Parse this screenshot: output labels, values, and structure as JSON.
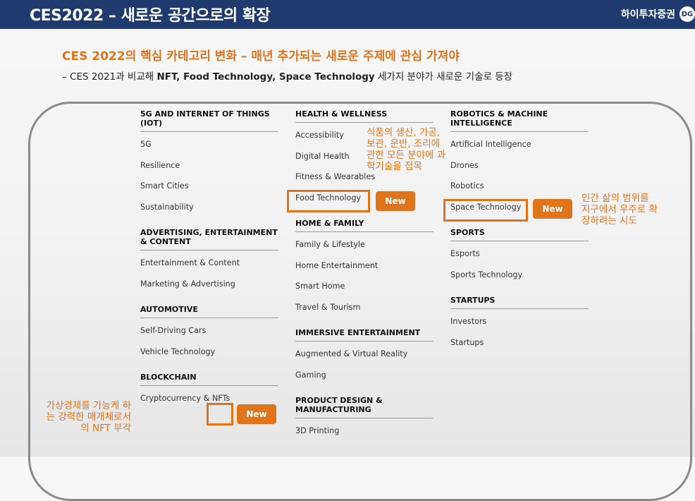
{
  "header": {
    "title": "CES2022 – 새로운 공간으로의 확장",
    "brand": "하이투자증권",
    "brand_logo": "DG"
  },
  "headline": "CES 2022의 핵심 카테고리 변화 – 매년 추가되는 새로운 주제에 관심 가져야",
  "subline": {
    "prefix": "– CES 2021과 비교해 ",
    "bold": "NFT, Food Technology, Space Technology",
    "suffix": " 세가지 분야가 새로운 기술로 등장"
  },
  "accent_color": "#e0741a",
  "columns": [
    {
      "sections": [
        {
          "title": "5G AND INTERNET OF THINGS (IOT)",
          "items": [
            "5G",
            "Resilience",
            "Smart Cities",
            "Sustainability"
          ]
        },
        {
          "title": "ADVERTISING, ENTERTAINMENT & CONTENT",
          "items": [
            "Entertainment & Content",
            "Marketing & Advertising"
          ]
        },
        {
          "title": "AUTOMOTIVE",
          "items": [
            "Self-Driving Cars",
            "Vehicle Technology"
          ]
        },
        {
          "title": "BLOCKCHAIN",
          "items": [
            "Cryptocurrency & NFTs"
          ]
        }
      ]
    },
    {
      "sections": [
        {
          "title": "HEALTH & WELLNESS",
          "items": [
            "Accessibility",
            "Digital Health",
            "Fitness & Wearables",
            "Food Technology"
          ]
        },
        {
          "title": "HOME & FAMILY",
          "items": [
            "Family & Lifestyle",
            "Home Entertainment",
            "Smart Home",
            "Travel & Tourism"
          ]
        },
        {
          "title": "IMMERSIVE ENTERTAINMENT",
          "items": [
            "Augmented & Virtual Reality",
            "Gaming"
          ]
        },
        {
          "title": "PRODUCT DESIGN & MANUFACTURING",
          "items": [
            "3D Printing"
          ]
        }
      ]
    },
    {
      "sections": [
        {
          "title": "ROBOTICS & MACHINE INTELLIGENCE",
          "items": [
            "Artificial Intelligence",
            "Drones",
            "Robotics",
            "Space Technology"
          ]
        },
        {
          "title": "SPORTS",
          "items": [
            "Esports",
            "Sports Technology"
          ]
        },
        {
          "title": "STARTUPS",
          "items": [
            "Investors",
            "Startups"
          ]
        }
      ]
    }
  ],
  "new_badge": "New",
  "notes": {
    "food": "식품의 생산, 가공, 보관, 운반, 조리에 관한 모든 분야에 과학기술을 접목",
    "space": "인간 삶의 범위를 지구에서 우주로 확장하려는 시도",
    "nft": "가상경제를 가능케 하는 강력한 매개체로서의 NFT 부각"
  }
}
